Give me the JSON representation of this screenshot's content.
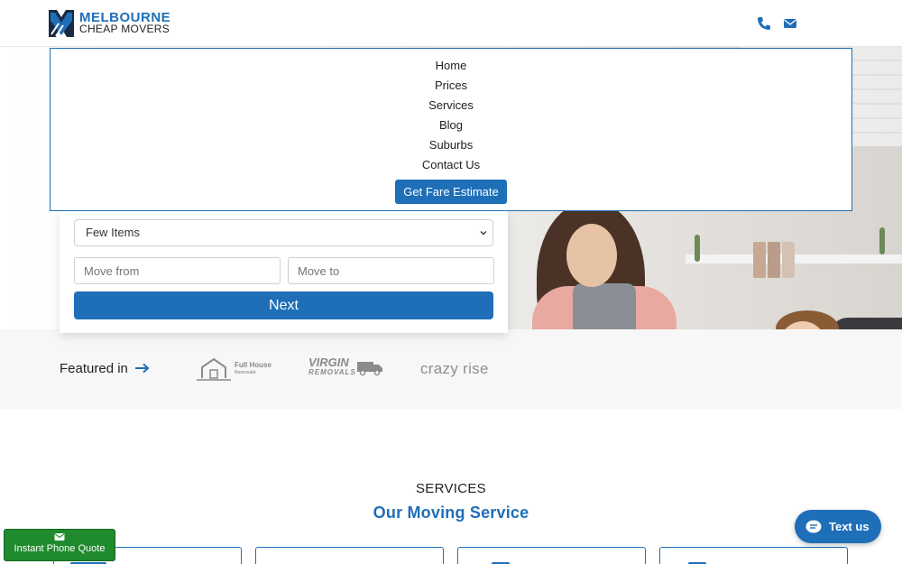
{
  "header": {
    "brand_line1": "MELBOURNE",
    "brand_line2": "CHEAP MOVERS",
    "icons": [
      "phone-icon",
      "envelope-icon"
    ]
  },
  "nav": {
    "items": [
      "Home",
      "Prices",
      "Services",
      "Blog",
      "Suburbs",
      "Contact Us"
    ],
    "cta": "Get Fare Estimate"
  },
  "form": {
    "size_selected": "Few Items",
    "move_from_placeholder": "Move from",
    "move_to_placeholder": "Move to",
    "submit": "Next"
  },
  "featured": {
    "label": "Featured in",
    "brands": {
      "fullhouse": "Full House",
      "fullhouse_sub": "Removals",
      "virgin": "VIRGIN",
      "virgin_sub": "REMOVALS",
      "crazy": "crazy rise"
    }
  },
  "services": {
    "eyebrow": "SERVICES",
    "title": "Our Moving Service"
  },
  "widgets": {
    "text_us": "Text us",
    "phone_quote": "Instant Phone Quote"
  },
  "colors": {
    "brand_blue": "#1e6fb8",
    "quote_green": "#1f8a2e"
  }
}
